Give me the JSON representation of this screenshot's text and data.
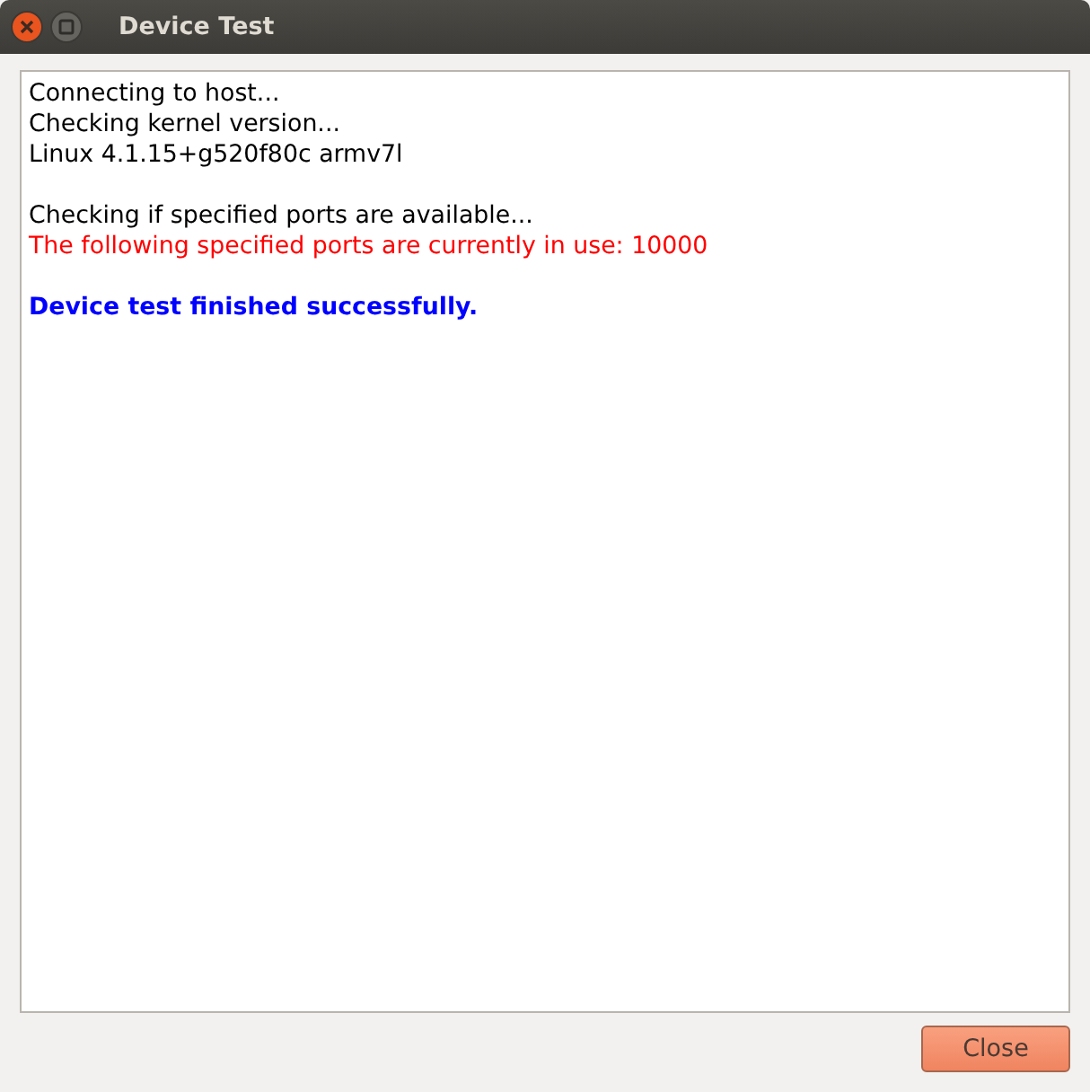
{
  "window": {
    "title": "Device Test"
  },
  "log": [
    {
      "lines": [
        {
          "text": "Connecting to host...",
          "kind": "info"
        },
        {
          "text": "Checking kernel version...",
          "kind": "info"
        },
        {
          "text": "Linux 4.1.15+g520f80c armv7l",
          "kind": "info"
        }
      ]
    },
    {
      "lines": [
        {
          "text": "Checking if specified ports are available...",
          "kind": "info"
        },
        {
          "text": "The following specified ports are currently in use: 10000",
          "kind": "error"
        }
      ]
    },
    {
      "lines": [
        {
          "text": "Device test finished successfully.",
          "kind": "success"
        }
      ]
    }
  ],
  "buttons": [
    {
      "label": "Close"
    }
  ]
}
